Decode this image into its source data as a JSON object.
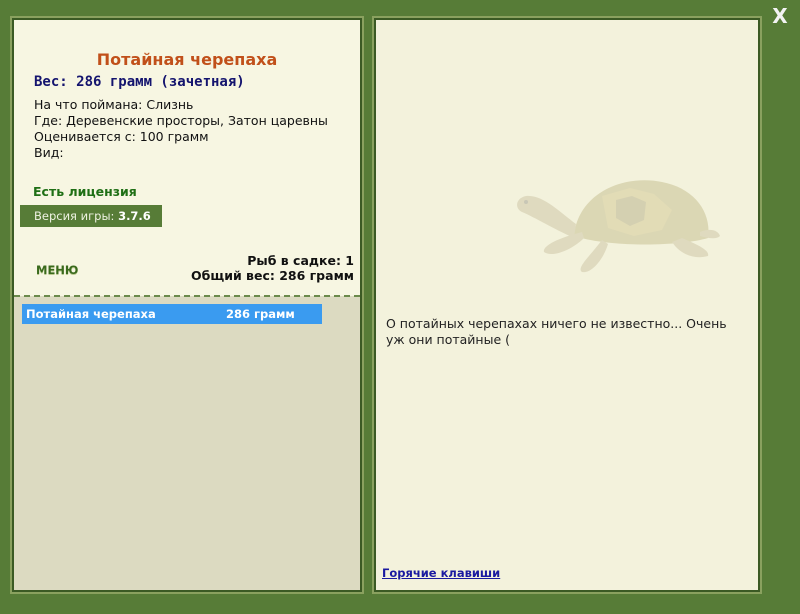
{
  "window": {
    "close_label": "X"
  },
  "fish": {
    "title": "Потайная черепаха",
    "weight_line": "Вес: 286 грамм (зачетная)",
    "info": [
      "На что поймана: Слизнь",
      "Где: Деревенские просторы, Затон царевны",
      "Оценивается с: 100 грамм",
      "Вид:"
    ]
  },
  "license": "Есть лицензия",
  "version": {
    "label": "Версия игры:",
    "value": "3.7.6"
  },
  "menu_label": "МЕНЮ",
  "cage": {
    "count_line": "Рыб в садке: 1",
    "total_line": "Общий вес: 286 грамм"
  },
  "catch_list": [
    {
      "name": "Потайная черепаха",
      "weight": "286 грамм"
    }
  ],
  "description": "О потайных черепахах ничего не известно... Очень уж они потайные (",
  "hotkeys_label": "Горячие клавиши",
  "colors": {
    "frame": "#577c37",
    "panel_bg": "#f3f2dc",
    "title": "#c1501a",
    "weight": "#14146e",
    "license": "#1f6f15",
    "selected_row": "#3a9bf0",
    "link": "#1a1aa0"
  },
  "icons": {
    "close": "close-icon",
    "turtle": "turtle-image"
  }
}
